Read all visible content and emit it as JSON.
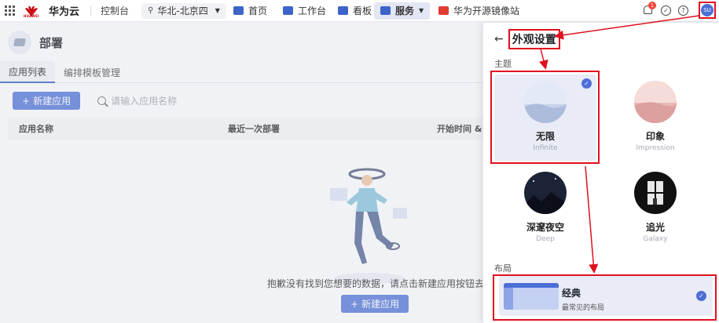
{
  "topbar": {
    "brand": "华为云",
    "logo_text": "HUAWEI",
    "console": "控制台",
    "region": "华北-北京四",
    "nav": {
      "home": "首页",
      "workbench": "工作台",
      "board": "看板",
      "service": "服务",
      "mirror": "华为开源镜像站"
    },
    "notification_count": "1",
    "avatar": "SU"
  },
  "page": {
    "title": "部署",
    "tabs": [
      "应用列表",
      "编排模板管理"
    ],
    "new_button": "新建应用",
    "search_placeholder": "请输入应用名称",
    "columns": [
      "应用名称",
      "最近一次部署",
      "开始时间 & 部署"
    ],
    "empty_text": "抱歉没有找到您想要的数据，请点击新建应用按钮去新建吧",
    "empty_button": "新建应用"
  },
  "drawer": {
    "title": "外观设置",
    "theme_label": "主题",
    "themes": [
      {
        "name": "无限",
        "en": "Infinite",
        "selected": true
      },
      {
        "name": "印象",
        "en": "Impression",
        "selected": false
      },
      {
        "name": "深邃夜空",
        "en": "Deep",
        "selected": false
      },
      {
        "name": "追光",
        "en": "Galaxy",
        "selected": false
      }
    ],
    "layout_label": "布局",
    "layout": {
      "name": "经典",
      "desc": "最常见的布局",
      "selected": true
    }
  },
  "colors": {
    "accent": "#4b6fd6",
    "highlight": "#e0101e"
  }
}
